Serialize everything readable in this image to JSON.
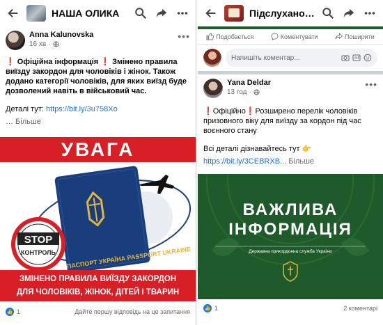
{
  "left": {
    "header": {
      "title": "НАША  ОЛИКА"
    },
    "post": {
      "author": "Anna Kalunovska",
      "time": "16 хв",
      "emoji_mark": "❗",
      "text": "Офіційна інформація",
      "text_rest": "Змінено правила виїзду закордон для чоловіків і жінок. Також додано  категорії чоловіків, для яких виїзд буде дозволений навіть в військовий  час.",
      "details_label": "Деталі тут:",
      "details_link": "https://bit.ly/3u758Xo",
      "more": "… Більше"
    },
    "image": {
      "headline": "УВАГА",
      "stop_label": "STOP",
      "stop_sub": "КОНТРОЛЬ",
      "passport_text": "ПАСПОРТ УКРАЇНА PASSPORT UKRAINE",
      "banner_line1": "ЗМІНЕНО ПРАВИЛА ВИЇЗДУ ЗАКОРДОН",
      "banner_line2": "ДЛЯ ЧОЛОВІКІВ, ЖІНОК, ДІТЕЙ І ТВАРИН"
    },
    "footer": {
      "likes": "1",
      "reply": "Дайте першу відповідь на це запитання"
    }
  },
  "right": {
    "header": {
      "title": "Підслухано Го..."
    },
    "actions": {
      "like": "Подобається",
      "comment": "Коментувати",
      "share": "Поширити"
    },
    "comment_placeholder": "Напишіть коментар...",
    "post": {
      "author": "Yana Deldar",
      "time": "13 год",
      "text": "❗Офіційно❗Розширено перелік  чоловіків призовного віку для виїзду за кордон під час воєнного стану",
      "details": "Всі деталі дізнавайтесь тут 👉",
      "link": "https://bit.ly/3CEBRXB...",
      "more": "Більше"
    },
    "image": {
      "line1": "ВАЖЛИВА",
      "line2": "ІНФОРМАЦІЯ",
      "caption": "Державна прикордонна служба України"
    },
    "footer": {
      "likes": "1",
      "comments": "2 коментарі"
    }
  },
  "colors": {
    "fb_blue": "#1877f2",
    "link": "#216fdb",
    "red": "#d81f26",
    "green": "#1f5a2a",
    "passport": "#1a3d7c",
    "gold": "#e0b73f"
  },
  "icons": [
    "back-arrow-icon",
    "search-icon",
    "share-arrow-icon",
    "more-dots-icon",
    "globe-icon",
    "like-icon",
    "comment-icon",
    "camera-icon",
    "gif-icon",
    "sticker-icon"
  ]
}
